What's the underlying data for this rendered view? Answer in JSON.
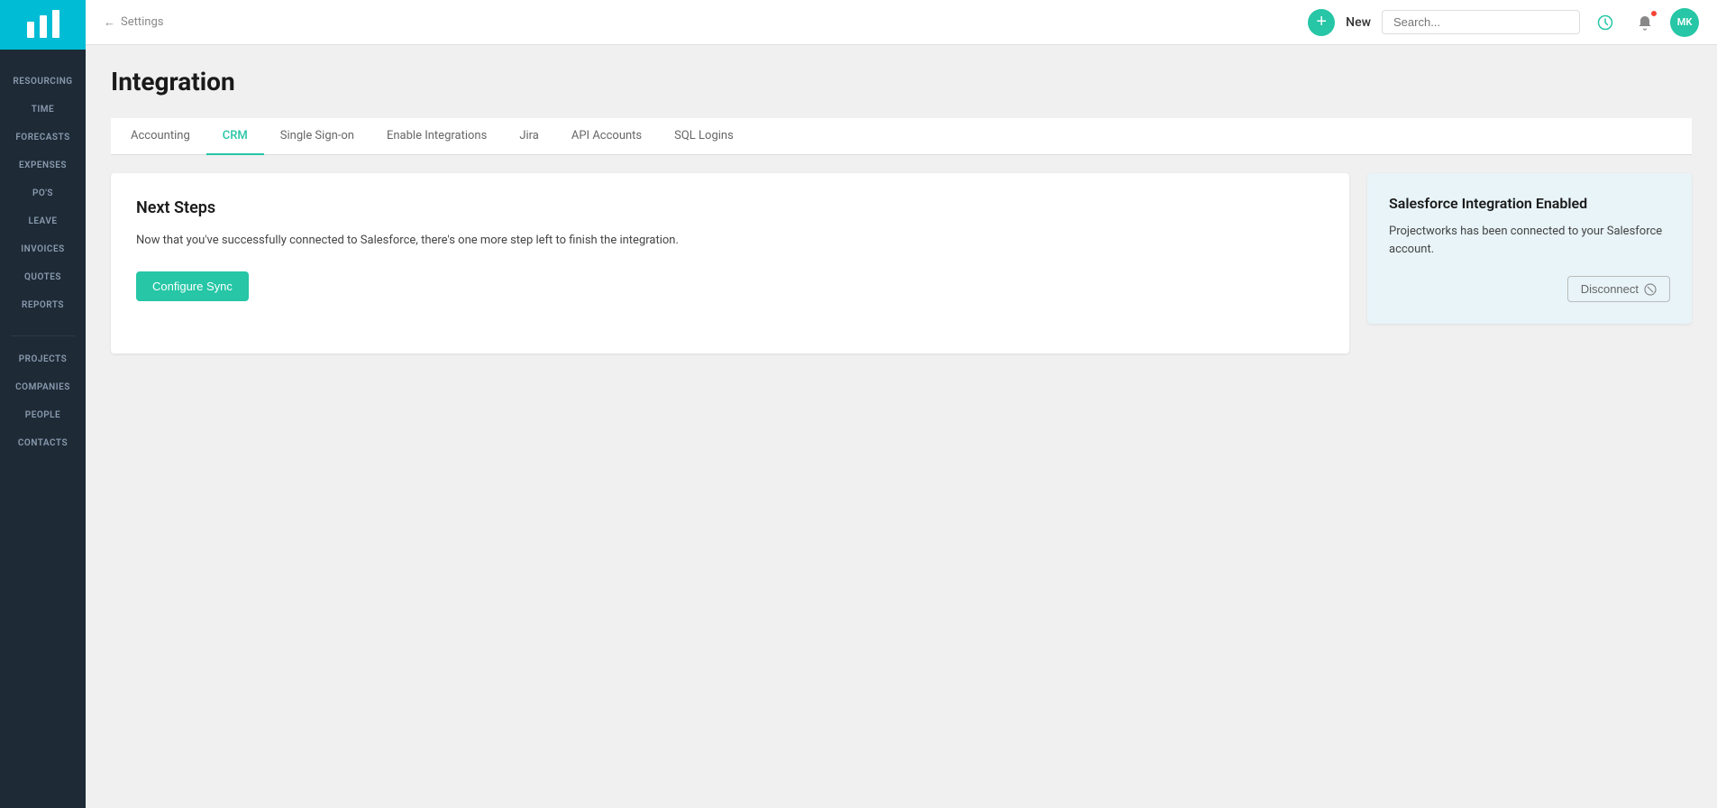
{
  "sidebar": {
    "logo_alt": "Projectworks logo",
    "items_top": [
      {
        "label": "RESOURCING",
        "id": "resourcing"
      },
      {
        "label": "TIME",
        "id": "time"
      },
      {
        "label": "FORECASTS",
        "id": "forecasts"
      },
      {
        "label": "EXPENSES",
        "id": "expenses"
      },
      {
        "label": "PO'S",
        "id": "pos"
      },
      {
        "label": "LEAVE",
        "id": "leave"
      },
      {
        "label": "INVOICES",
        "id": "invoices"
      },
      {
        "label": "QUOTES",
        "id": "quotes"
      },
      {
        "label": "REPORTS",
        "id": "reports"
      }
    ],
    "items_bottom": [
      {
        "label": "PROJECTS",
        "id": "projects"
      },
      {
        "label": "COMPANIES",
        "id": "companies"
      },
      {
        "label": "PEOPLE",
        "id": "people"
      },
      {
        "label": "CONTACTS",
        "id": "contacts"
      }
    ]
  },
  "header": {
    "back_label": "Settings",
    "new_label": "New",
    "search_placeholder": "Search...",
    "avatar_initials": "MK"
  },
  "page": {
    "title": "Integration"
  },
  "tabs": [
    {
      "label": "Accounting",
      "id": "accounting",
      "active": false
    },
    {
      "label": "CRM",
      "id": "crm",
      "active": true
    },
    {
      "label": "Single Sign-on",
      "id": "sso",
      "active": false
    },
    {
      "label": "Enable Integrations",
      "id": "enable",
      "active": false
    },
    {
      "label": "Jira",
      "id": "jira",
      "active": false
    },
    {
      "label": "API Accounts",
      "id": "api",
      "active": false
    },
    {
      "label": "SQL Logins",
      "id": "sql",
      "active": false
    }
  ],
  "main_card": {
    "title": "Next Steps",
    "description": "Now that you've successfully connected to Salesforce, there's one more step left to finish the integration.",
    "configure_btn_label": "Configure Sync"
  },
  "side_card": {
    "title": "Salesforce Integration Enabled",
    "description": "Projectworks has been connected to your Salesforce account.",
    "disconnect_label": "Disconnect"
  }
}
